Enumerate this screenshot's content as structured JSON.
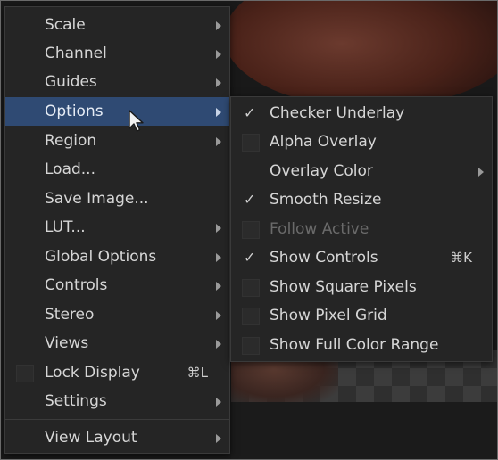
{
  "main_menu": {
    "items": [
      {
        "label": "Scale"
      },
      {
        "label": "Channel"
      },
      {
        "label": "Guides"
      },
      {
        "label": "Options"
      },
      {
        "label": "Region"
      },
      {
        "label": "Load..."
      },
      {
        "label": "Save Image..."
      },
      {
        "label": "LUT..."
      },
      {
        "label": "Global Options"
      },
      {
        "label": "Controls"
      },
      {
        "label": "Stereo"
      },
      {
        "label": "Views"
      },
      {
        "label": "Lock Display",
        "shortcut": "⌘L"
      },
      {
        "label": "Settings"
      },
      {
        "label": "View Layout"
      }
    ]
  },
  "options_submenu": {
    "items": [
      {
        "label": "Checker Underlay",
        "checked": true
      },
      {
        "label": "Alpha Overlay",
        "checked": false
      },
      {
        "label": "Overlay Color"
      },
      {
        "label": "Smooth Resize",
        "checked": true
      },
      {
        "label": "Follow Active",
        "disabled": true
      },
      {
        "label": "Show Controls",
        "checked": true,
        "shortcut": "⌘K"
      },
      {
        "label": "Show Square Pixels",
        "checked": false
      },
      {
        "label": "Show Pixel Grid",
        "checked": false
      },
      {
        "label": "Show Full Color Range",
        "checked": false
      }
    ],
    "check_glyph": "✓"
  },
  "colors": {
    "menu_bg": "#252525",
    "highlight": "#2f4a73",
    "text": "#d6d6d6",
    "disabled_text": "#6a6a6a"
  }
}
